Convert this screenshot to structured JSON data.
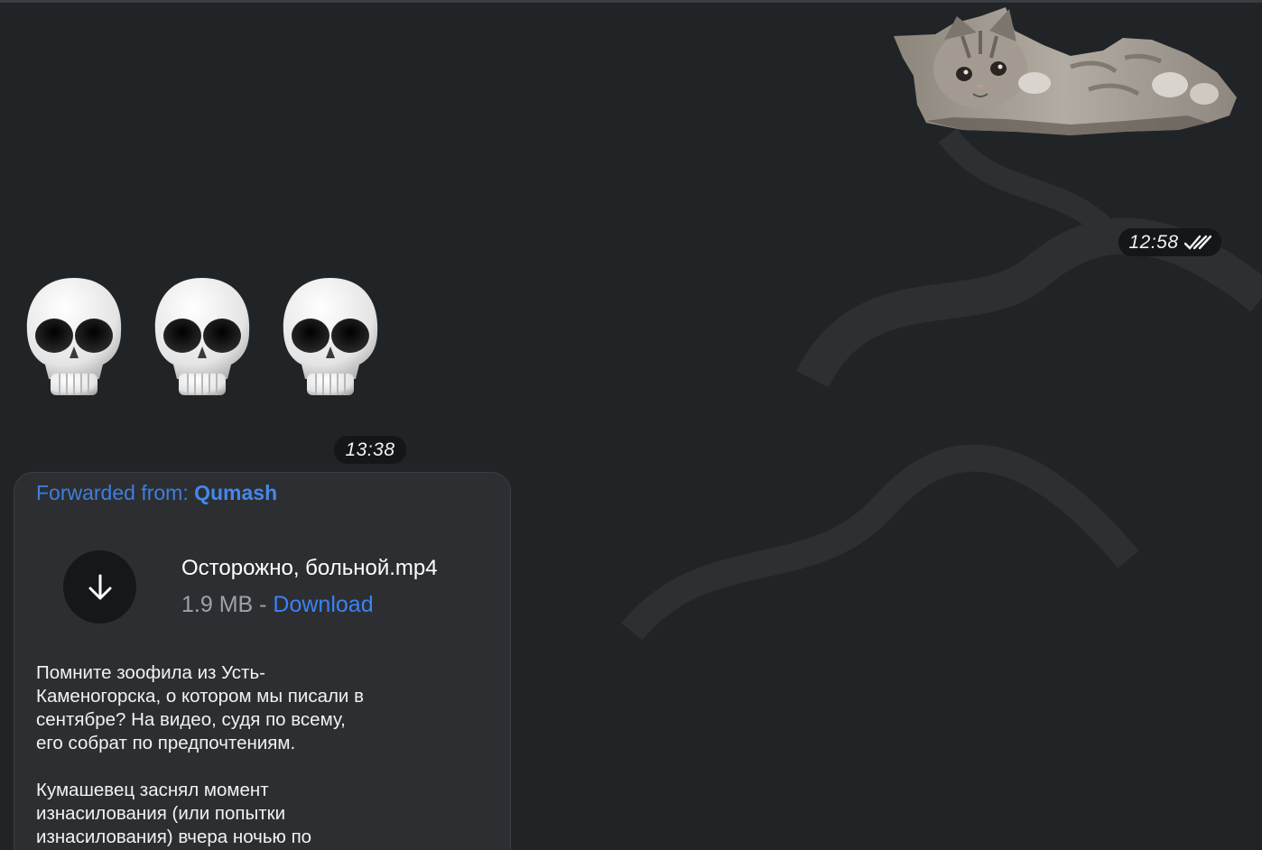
{
  "chat": {
    "messages": [
      {
        "type": "sticker",
        "sticker_icon": "kitten-sticker",
        "time": "12:58",
        "status_icon": "double-check-icon"
      },
      {
        "type": "emoji",
        "emojis": [
          "💀",
          "💀",
          "💀"
        ],
        "time": "13:38"
      },
      {
        "type": "file",
        "forwarded_label": "Forwarded from:",
        "forwarded_from": "Qumash",
        "file_name": "Осторожно, больной.mp4",
        "file_size": "1.9 MB",
        "separator": " - ",
        "download_label": "Download",
        "download_icon": "arrow-down-icon",
        "paragraph_1": "Помните зоофила из Усть-\nКаменогорска, о котором мы писали в\nсентябре? На видео, судя по всему,\nего собрат по предпочтениям.",
        "paragraph_2": "Кумашевец заснял момент\nизнасилования (или попытки\nизнасилования) вчера ночью по"
      }
    ]
  },
  "colors": {
    "background": "#212427",
    "bubble": "#2c2e31",
    "link": "#3b82f6",
    "time_pill": "#141619"
  }
}
